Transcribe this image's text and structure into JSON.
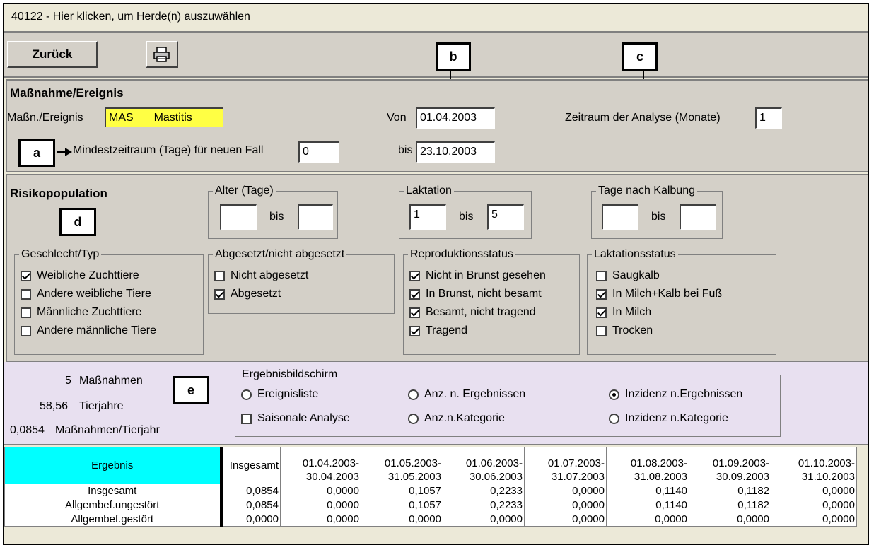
{
  "titlebar": {
    "text": "40122  - Hier klicken, um Herde(n) auszuwählen"
  },
  "toolbar": {
    "back_label": "Zurück",
    "print_icon": "printer-icon"
  },
  "callouts": {
    "a": "a",
    "b": "b",
    "c": "c",
    "d": "d",
    "e": "e"
  },
  "massnahme": {
    "title": "Maßnahme/Ereignis",
    "event_label": "Maßn./Ereignis",
    "event_code": "MAS",
    "event_name": "Mastitis",
    "min_period_label": "Mindestzeitraum (Tage) für neuen Fall",
    "min_period_value": "0",
    "from_label": "Von",
    "from_value": "01.04.2003",
    "to_label": "bis",
    "to_value": "23.10.2003",
    "period_label": "Zeitraum der Analyse (Monate)",
    "period_value": "1"
  },
  "risk": {
    "title": "Risikopopulation",
    "age": {
      "title": "Alter (Tage)",
      "from": "",
      "bis": "bis",
      "to": ""
    },
    "lactation": {
      "title": "Laktation",
      "from": "1",
      "bis": "bis",
      "to": "5"
    },
    "days_after_calving": {
      "title": "Tage nach Kalbung",
      "from": "",
      "bis": "bis",
      "to": ""
    },
    "sex": {
      "title": "Geschlecht/Typ",
      "items": [
        {
          "label": "Weibliche Zuchttiere",
          "checked": true
        },
        {
          "label": "Andere weibliche Tiere",
          "checked": false
        },
        {
          "label": "Männliche Zuchttiere",
          "checked": false
        },
        {
          "label": "Andere männliche Tiere",
          "checked": false
        }
      ]
    },
    "weaned": {
      "title": "Abgesetzt/nicht abgesetzt",
      "items": [
        {
          "label": "Nicht abgesetzt",
          "checked": false
        },
        {
          "label": "Abgesetzt",
          "checked": true
        }
      ]
    },
    "repro": {
      "title": "Reproduktionsstatus",
      "items": [
        {
          "label": "Nicht in Brunst gesehen",
          "checked": true
        },
        {
          "label": "In Brunst, nicht besamt",
          "checked": true
        },
        {
          "label": "Besamt, nicht tragend",
          "checked": true
        },
        {
          "label": "Tragend",
          "checked": true
        }
      ]
    },
    "lact_status": {
      "title": "Laktationsstatus",
      "items": [
        {
          "label": "Saugkalb",
          "checked": false
        },
        {
          "label": "In Milch+Kalb bei Fuß",
          "checked": true
        },
        {
          "label": "In Milch",
          "checked": true
        },
        {
          "label": "Trocken",
          "checked": false
        }
      ]
    }
  },
  "summary": {
    "measures_count": "5",
    "measures_label": "Maßnahmen",
    "animal_years_value": "58,56",
    "animal_years_label": "Tierjahre",
    "rate_value": "0,0854",
    "rate_label": "Maßnahmen/Tierjahr"
  },
  "result_screen": {
    "title": "Ergebnisbildschirm",
    "options": [
      {
        "label": "Ereignisliste",
        "selected": false
      },
      {
        "label": "Anz. n. Ergebnissen",
        "selected": false
      },
      {
        "label": "Inzidenz n.Ergebnissen",
        "selected": true
      },
      {
        "label": "Anz.n.Kategorie",
        "selected": false
      },
      {
        "label": "Inzidenz n.Kategorie",
        "selected": false
      }
    ],
    "seasonal_label": "Saisonale Analyse",
    "seasonal_checked": false
  },
  "table": {
    "header_main": "Ergebnis",
    "header_total": "Insgesamt",
    "period_headers": [
      [
        "01.04.2003-",
        "30.04.2003"
      ],
      [
        "01.05.2003-",
        "31.05.2003"
      ],
      [
        "01.06.2003-",
        "30.06.2003"
      ],
      [
        "01.07.2003-",
        "31.07.2003"
      ],
      [
        "01.08.2003-",
        "31.08.2003"
      ],
      [
        "01.09.2003-",
        "30.09.2003"
      ],
      [
        "01.10.2003-",
        "31.10.2003"
      ]
    ],
    "rows": [
      {
        "label": "Insgesamt",
        "values": [
          "0,0854",
          "0,0000",
          "0,1057",
          "0,2233",
          "0,0000",
          "0,1140",
          "0,1182",
          "0,0000"
        ]
      },
      {
        "label": "Allgembef.ungestört",
        "values": [
          "0,0854",
          "0,0000",
          "0,1057",
          "0,2233",
          "0,0000",
          "0,1140",
          "0,1182",
          "0,0000"
        ]
      },
      {
        "label": "Allgembef.gestört",
        "values": [
          "0,0000",
          "0,0000",
          "0,0000",
          "0,0000",
          "0,0000",
          "0,0000",
          "0,0000",
          "0,0000"
        ]
      }
    ]
  }
}
